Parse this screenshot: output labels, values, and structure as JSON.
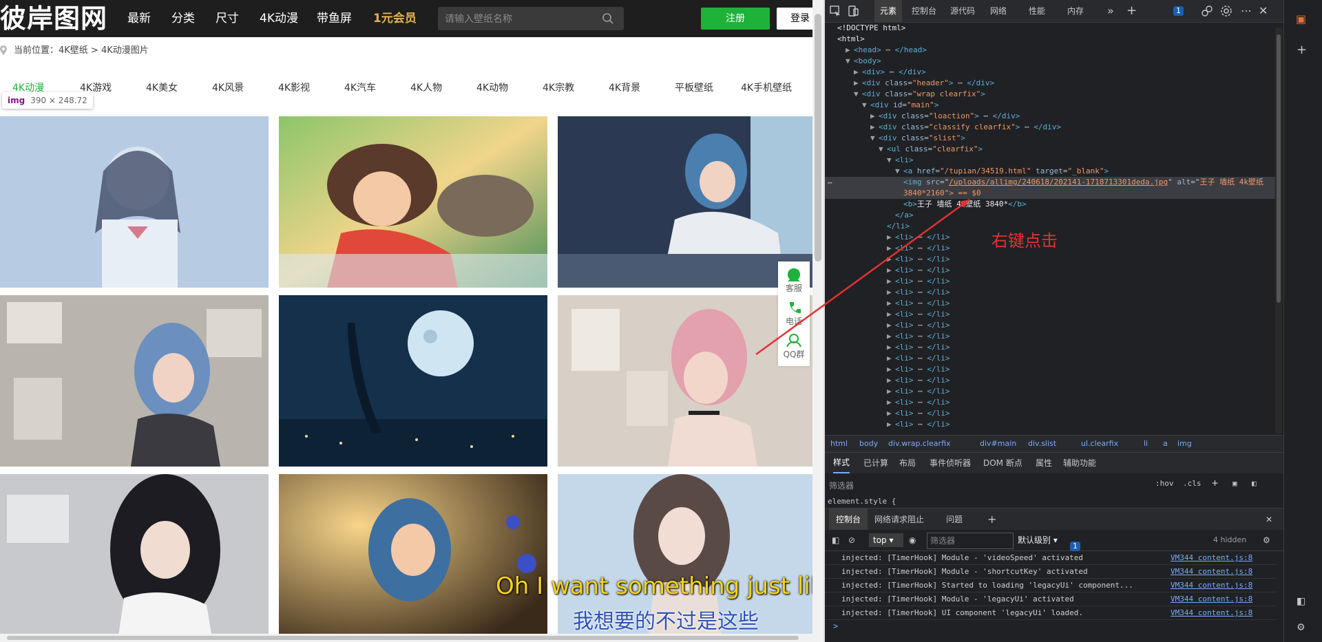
{
  "site": {
    "logo": "彼岸图网",
    "nav": [
      "最新",
      "分类",
      "尺寸",
      "4K动漫",
      "带鱼屏",
      "1元会员"
    ],
    "search_placeholder": "请输入壁纸名称",
    "register": "注册",
    "login": "登录",
    "breadcrumb": "当前位置：4K壁纸 > 4K动漫图片",
    "tabs": [
      "4K动漫",
      "4K游戏",
      "4K美女",
      "4K风景",
      "4K影视",
      "4K汽车",
      "4K人物",
      "4K动物",
      "4K宗教",
      "4K背景",
      "平板壁纸",
      "4K手机壁纸"
    ],
    "img_badge_tag": "img",
    "img_badge_dim": "390 × 248.72",
    "float": [
      "客服",
      "电话",
      "QQ群"
    ],
    "subtitle_en": "Oh I want something just like this",
    "subtitle_cn": "我想要的不过是这些",
    "accent_green": "#1db33b",
    "vip_color": "#e6b24c"
  },
  "devtools": {
    "tabs": [
      "元素",
      "控制台",
      "源代码",
      "网络",
      "性能",
      "内存"
    ],
    "issue_count": "1",
    "dom_lines": [
      {
        "indent": 0,
        "html": "<!DOCTYPE html>"
      },
      {
        "indent": 0,
        "html": "<html>"
      },
      {
        "indent": 1,
        "tri": "▶",
        "tag": "head",
        "collapsed": true
      },
      {
        "indent": 1,
        "tri": "▼",
        "open": "body"
      },
      {
        "indent": 2,
        "tri": "▶",
        "tag": "div",
        "collapsed": true
      },
      {
        "indent": 2,
        "tri": "▶",
        "tag": "div",
        "attrs": [
          [
            "class",
            "header"
          ]
        ],
        "collapsed": true
      },
      {
        "indent": 2,
        "tri": "▼",
        "open": "div",
        "attrs": [
          [
            "class",
            "wrap clearfix"
          ]
        ]
      },
      {
        "indent": 3,
        "tri": "▼",
        "open": "div",
        "attrs": [
          [
            "id",
            "main"
          ]
        ]
      },
      {
        "indent": 4,
        "tri": "▶",
        "tag": "div",
        "attrs": [
          [
            "class",
            "loaction"
          ]
        ],
        "collapsed": true
      },
      {
        "indent": 4,
        "tri": "▶",
        "tag": "div",
        "attrs": [
          [
            "class",
            "classify clearfix"
          ]
        ],
        "collapsed": true
      },
      {
        "indent": 4,
        "tri": "▼",
        "open": "div",
        "attrs": [
          [
            "class",
            "slist"
          ]
        ]
      },
      {
        "indent": 5,
        "tri": "▼",
        "open": "ul",
        "attrs": [
          [
            "class",
            "clearfix"
          ]
        ]
      },
      {
        "indent": 6,
        "tri": "▼",
        "open": "li"
      },
      {
        "indent": 7,
        "tri": "▼",
        "open": "a",
        "attrs": [
          [
            "href",
            "/tupian/34519.html"
          ],
          [
            "target",
            "_blank"
          ]
        ]
      },
      {
        "indent": 8,
        "sel": true,
        "img": true,
        "src": "/uploads/allimg/240618/202141-1718713301deda.jpg",
        "alt": "王子 墙纸 4k壁纸"
      },
      {
        "indent": 8,
        "sel": true,
        "cont": "3840*2160\"> == $0"
      },
      {
        "indent": 8,
        "btext": "王子 墙纸 4k壁纸 3840*"
      },
      {
        "indent": 7,
        "close": "a"
      },
      {
        "indent": 6,
        "close": "li"
      }
    ],
    "li_rows": 18,
    "annotation": "右键点击",
    "crumbs": [
      "html",
      "body",
      "div.wrap.clearfix",
      "div#main",
      "div.slist",
      "ul.clearfix",
      "li",
      "a",
      "img"
    ],
    "styles_tabs": [
      "样式",
      "已计算",
      "布局",
      "事件侦听器",
      "DOM 断点",
      "属性",
      "辅助功能"
    ],
    "filter_placeholder": "筛选器",
    "hov": ":hov",
    "cls": ".cls",
    "element_style": "element.style {",
    "console_tabs": [
      "控制台",
      "网络请求阻止",
      "问题"
    ],
    "context": "top",
    "console_filter_placeholder": "筛选器",
    "level": "默认级别",
    "hidden": "4 hidden",
    "console_messages": [
      "injected: [TimerHook] Module - 'videoSpeed' activated",
      "injected: [TimerHook] Module - 'shortcutKey' activated",
      "injected: [TimerHook] Started to loading 'legacyUi' component...",
      "injected: [TimerHook] Module - 'legacyUi' activated",
      "injected: [TimerHook] UI component 'legacyUi' loaded."
    ],
    "console_source": "VM344 content.js:8",
    "prompt": ">"
  }
}
